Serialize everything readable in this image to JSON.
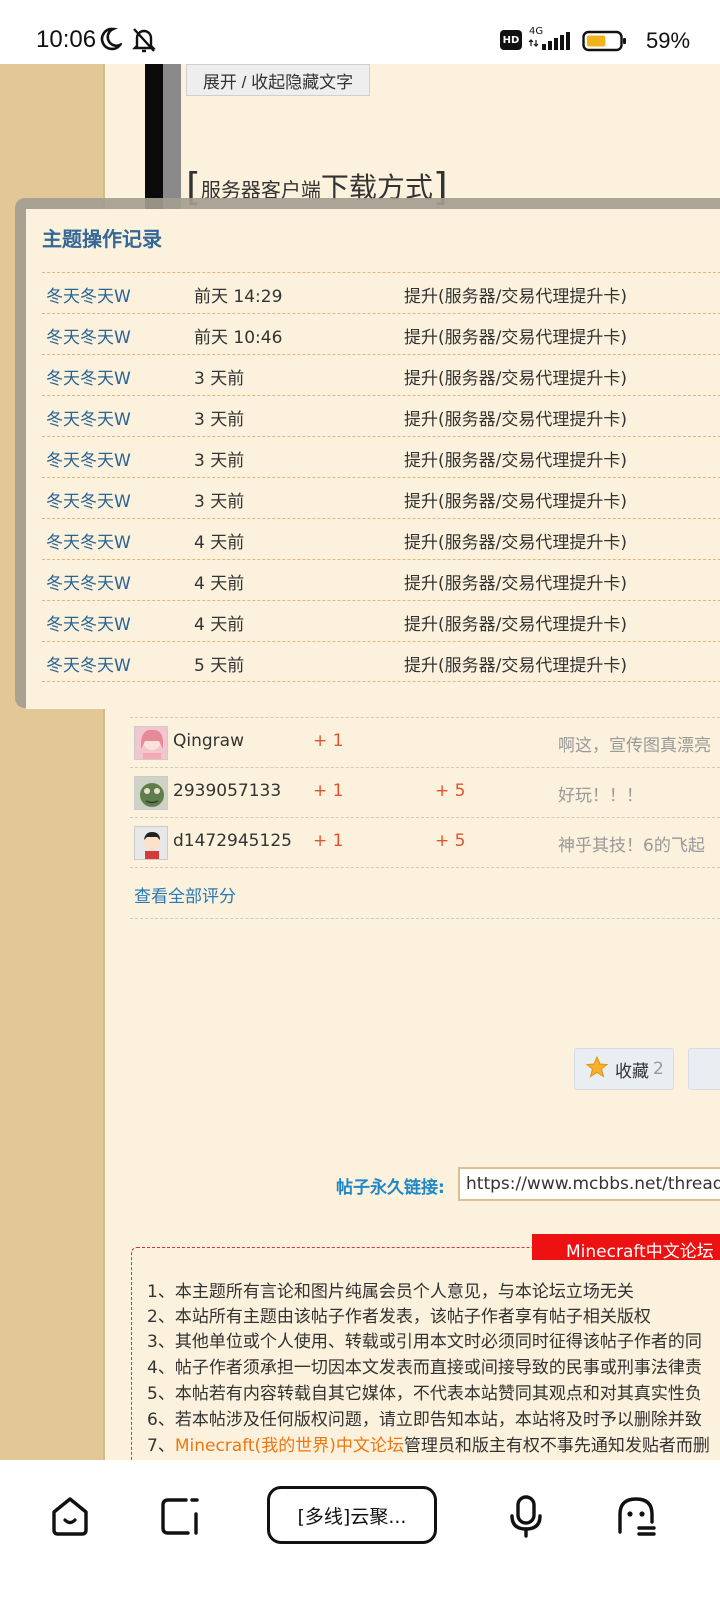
{
  "status_bar": {
    "time": "10:06",
    "network": "4G",
    "hd_badge": "HD",
    "battery_percent": 59,
    "battery_label": "59%"
  },
  "post": {
    "toggle_hidden_label": "展开 / 收起隐藏文字",
    "section_heading_small": "服务器客户端",
    "section_heading_large": "下载方式"
  },
  "modal": {
    "title": "主题操作记录",
    "rows": [
      {
        "user": "冬天冬天W",
        "time": "前天 14:29",
        "action": "提升(服务器/交易代理提升卡)"
      },
      {
        "user": "冬天冬天W",
        "time": "前天 10:46",
        "action": "提升(服务器/交易代理提升卡)"
      },
      {
        "user": "冬天冬天W",
        "time": "3 天前",
        "action": "提升(服务器/交易代理提升卡)"
      },
      {
        "user": "冬天冬天W",
        "time": "3 天前",
        "action": "提升(服务器/交易代理提升卡)"
      },
      {
        "user": "冬天冬天W",
        "time": "3 天前",
        "action": "提升(服务器/交易代理提升卡)"
      },
      {
        "user": "冬天冬天W",
        "time": "3 天前",
        "action": "提升(服务器/交易代理提升卡)"
      },
      {
        "user": "冬天冬天W",
        "time": "4 天前",
        "action": "提升(服务器/交易代理提升卡)"
      },
      {
        "user": "冬天冬天W",
        "time": "4 天前",
        "action": "提升(服务器/交易代理提升卡)"
      },
      {
        "user": "冬天冬天W",
        "time": "4 天前",
        "action": "提升(服务器/交易代理提升卡)"
      },
      {
        "user": "冬天冬天W",
        "time": "5 天前",
        "action": "提升(服务器/交易代理提升卡)"
      }
    ]
  },
  "ratings": {
    "rows": [
      {
        "name": "Qingraw",
        "score_a": "+ 1",
        "score_b": "",
        "comment": "啊这，宣传图真漂亮"
      },
      {
        "name": "2939057133",
        "score_a": "+ 1",
        "score_b": "+ 5",
        "comment": "好玩！！！"
      },
      {
        "name": "d1472945125",
        "score_a": "+ 1",
        "score_b": "+ 5",
        "comment": "神乎其技！6的飞起"
      }
    ],
    "view_all_label": "查看全部评分"
  },
  "actions": {
    "favorite_label": "收藏",
    "favorite_count": "2"
  },
  "permalink": {
    "label": "帖子永久链接:",
    "url": "https://www.mcbbs.net/thread-"
  },
  "disclaimer": {
    "banner": "Minecraft中文论坛",
    "lines": [
      "1、本主题所有言论和图片纯属会员个人意见，与本论坛立场无关",
      "2、本站所有主题由该帖子作者发表，该帖子作者享有帖子相关版权",
      "3、其他单位或个人使用、转载或引用本文时必须同时征得该帖子作者的同",
      "4、帖子作者须承担一切因本文发表而直接或间接导致的民事或刑事法律责",
      "5、本帖若有内容转载自其它媒体，不代表本站赞同其观点和对其真实性负",
      "6、若本帖涉及任何版权问题，请立即告知本站，本站将及时予以删除并致"
    ],
    "line7_prefix": "7、",
    "line7_link": "Minecraft(我的世界)中文论坛",
    "line7_suffix": "管理员和版主有权不事先通知发贴者而删"
  },
  "bottom_nav": {
    "tab_label": "[多线]云聚...",
    "icons": [
      "home-icon",
      "tabs-icon",
      "microphone-icon",
      "assistant-icon"
    ]
  },
  "colors": {
    "page_bg": "#fbf1dc",
    "left_strip": "#e2c897",
    "link_blue": "#2a6496",
    "modal_title": "#336699",
    "score_red": "#e0552e",
    "banner_red": "#ee1111"
  }
}
